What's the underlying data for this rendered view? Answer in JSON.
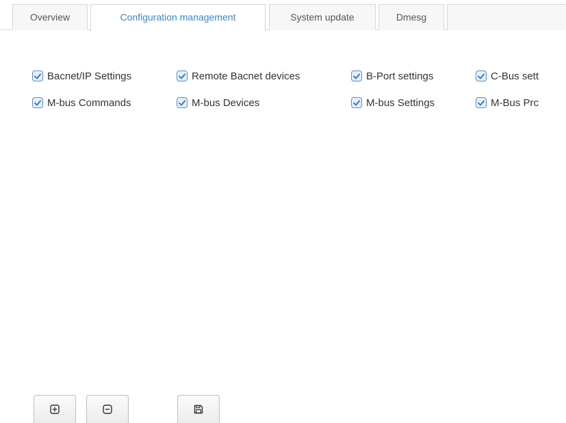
{
  "tabs": [
    {
      "label": "Overview",
      "active": false
    },
    {
      "label": "Configuration management",
      "active": true
    },
    {
      "label": "System update",
      "active": false
    },
    {
      "label": "Dmesg",
      "active": false
    }
  ],
  "checkboxes": [
    {
      "label": "Bacnet/IP Settings",
      "checked": true
    },
    {
      "label": "Remote Bacnet devices",
      "checked": true
    },
    {
      "label": "B-Port settings",
      "checked": true
    },
    {
      "label": "C-Bus sett",
      "checked": true
    },
    {
      "label": "M-bus Commands",
      "checked": true
    },
    {
      "label": "M-bus Devices",
      "checked": true
    },
    {
      "label": "M-bus Settings",
      "checked": true
    },
    {
      "label": "M-Bus Prc",
      "checked": true
    }
  ],
  "buttons": [
    {
      "icon": "plus-square-icon"
    },
    {
      "icon": "minus-square-icon"
    },
    {
      "icon": "floppy-disk-icon"
    }
  ],
  "colors": {
    "active_tab_text": "#3a86c8",
    "checkbox_border": "#5b8fc4",
    "checkbox_fill": "#e4effa",
    "text": "#333333"
  }
}
